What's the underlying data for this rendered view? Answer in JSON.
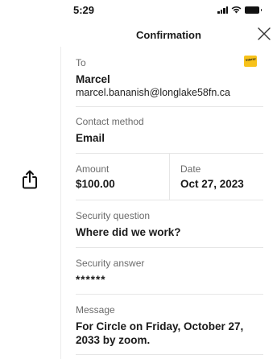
{
  "status_bar": {
    "time": "5:29"
  },
  "header": {
    "title": "Confirmation"
  },
  "logo": {
    "text": "Interac",
    "color": "#f7c21b"
  },
  "recipient": {
    "label": "To",
    "name": "Marcel",
    "email": "marcel.bananish@longlake58fn.ca"
  },
  "contact": {
    "label": "Contact method",
    "value": "Email"
  },
  "amount": {
    "label": "Amount",
    "value": "$100.00"
  },
  "date": {
    "label": "Date",
    "value": "Oct 27, 2023"
  },
  "security_question": {
    "label": "Security question",
    "value": "Where did we work?"
  },
  "security_answer": {
    "label": "Security answer",
    "value": "******"
  },
  "message": {
    "label": "Message",
    "line1": "For Circle on Friday, October 27,",
    "line2": "2033 by zoom."
  }
}
